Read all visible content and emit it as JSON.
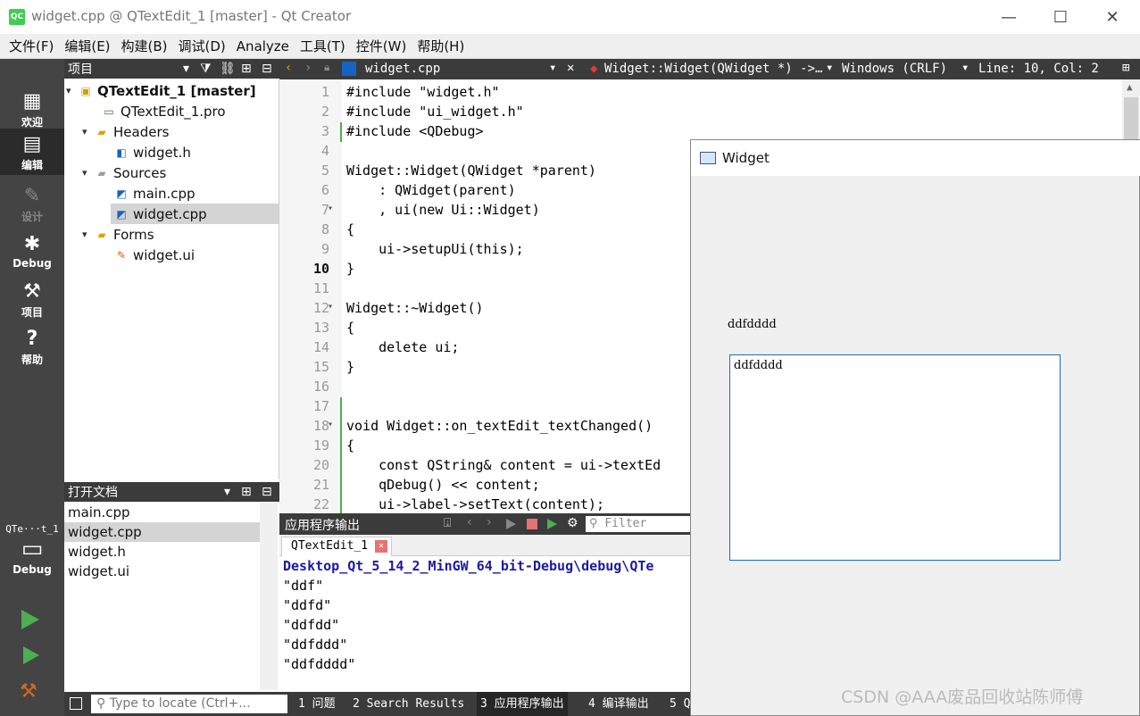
{
  "window": {
    "title": "widget.cpp @ QTextEdit_1 [master] - Qt Creator",
    "minimize": "—",
    "maximize": "☐",
    "close": "✕"
  },
  "menubar": [
    "文件(F)",
    "编辑(E)",
    "构建(B)",
    "调试(D)",
    "Analyze",
    "工具(T)",
    "控件(W)",
    "帮助(H)"
  ],
  "modes": [
    {
      "label": "欢迎",
      "icon": "grid-icon"
    },
    {
      "label": "编辑",
      "icon": "edit-icon"
    },
    {
      "label": "设计",
      "icon": "design-icon"
    },
    {
      "label": "Debug",
      "icon": "bug-icon"
    },
    {
      "label": "项目",
      "icon": "wrench-icon"
    },
    {
      "label": "帮助",
      "icon": "help-icon"
    }
  ],
  "kit": {
    "name": "QTe···t_1",
    "mode": "Debug"
  },
  "project_panel": {
    "title": "项目",
    "tree": [
      {
        "label": "QTextEdit_1 [master]",
        "depth": 0,
        "arrow": "▾",
        "bold": true
      },
      {
        "label": "QTextEdit_1.pro",
        "depth": 1,
        "arrow": ""
      },
      {
        "label": "Headers",
        "depth": 1,
        "arrow": "▾"
      },
      {
        "label": "widget.h",
        "depth": 2,
        "arrow": ""
      },
      {
        "label": "Sources",
        "depth": 1,
        "arrow": "▾"
      },
      {
        "label": "main.cpp",
        "depth": 2,
        "arrow": ""
      },
      {
        "label": "widget.cpp",
        "depth": 2,
        "arrow": "",
        "selected": true
      },
      {
        "label": "Forms",
        "depth": 1,
        "arrow": "▾"
      },
      {
        "label": "widget.ui",
        "depth": 2,
        "arrow": ""
      }
    ]
  },
  "open_docs": {
    "title": "打开文档",
    "items": [
      "main.cpp",
      "widget.cpp",
      "widget.h",
      "widget.ui"
    ],
    "selected": 1
  },
  "editor_toolbar": {
    "file": "widget.cpp",
    "symbol": "Widget::Widget(QWidget *) ->…",
    "line_ending": "Windows (CRLF)",
    "position": "Line: 10, Col: 2"
  },
  "editor": {
    "current_line": 10,
    "lines": [
      "#include \"widget.h\"",
      "#include \"ui_widget.h\"",
      "#include <QDebug>",
      "",
      "Widget::Widget(QWidget *parent)",
      "    : QWidget(parent)",
      "    , ui(new Ui::Widget)",
      "{",
      "    ui->setupUi(this);",
      "}",
      "",
      "Widget::~Widget()",
      "{",
      "    delete ui;",
      "}",
      "",
      "",
      "void Widget::on_textEdit_textChanged()",
      "{",
      "    const QString& content = ui->textEd",
      "    qDebug() << content;",
      "    ui->label->setText(content);"
    ]
  },
  "output": {
    "title": "应用程序输出",
    "filter_placeholder": "Filter",
    "tab": "QTextEdit_1",
    "lines": [
      "Desktop_Qt_5_14_2_MinGW_64_bit-Debug\\debug\\QTe",
      "\"ddf\"",
      "\"ddfd\"",
      "\"ddfdd\"",
      "\"ddfddd\"",
      "\"ddfdddd\""
    ]
  },
  "statusbar": {
    "locate_placeholder": "Type to locate (Ctrl+...",
    "tabs": [
      "1 问题",
      "2 Search Results",
      "3 应用程序输出",
      "4 编译输出",
      "5 Q"
    ]
  },
  "widget_window": {
    "title": "Widget",
    "label_text": "ddfdddd",
    "edit_text": "ddfdddd"
  },
  "watermark": "CSDN @AAA废品回收站陈师傅"
}
